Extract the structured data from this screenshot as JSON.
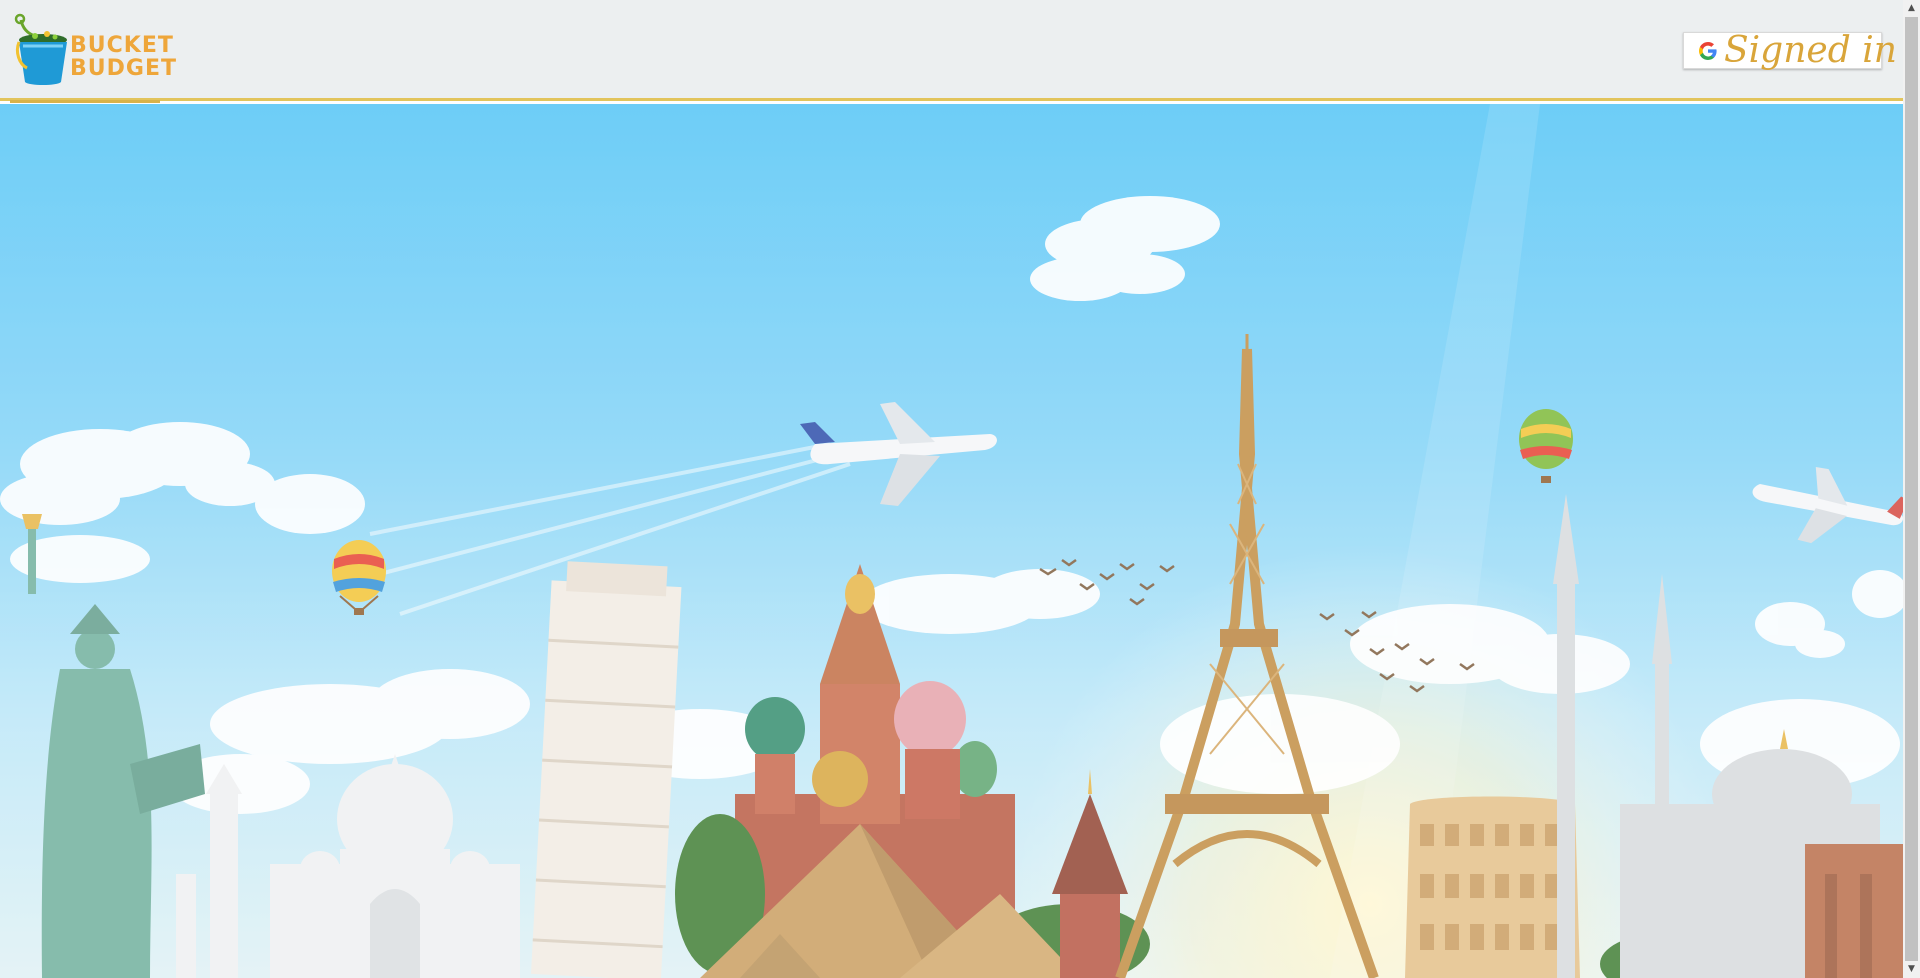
{
  "header": {
    "logo": {
      "line1": "BUCKET",
      "line2": "BUDGET"
    },
    "auth_button": {
      "icon": "google-g-icon",
      "label": "Signed in"
    }
  },
  "hero": {
    "image_semantic": "world-landmarks-banner",
    "landmarks": [
      "statue-of-liberty",
      "taj-mahal",
      "leaning-tower-of-pisa",
      "saint-basils-cathedral",
      "pyramids",
      "eiffel-tower",
      "colosseum",
      "hagia-sophia",
      "petra"
    ]
  },
  "scrollbar": {
    "up_icon": "▲",
    "down_icon": "▼"
  },
  "colors": {
    "header_bg": "#eceff0",
    "accent_gold": "#e2c45c",
    "logo_orange": "#eea63a",
    "signin_text": "#d9a53a",
    "sky_top": "#4ec3f6",
    "sky_bottom": "#dff1f4"
  }
}
